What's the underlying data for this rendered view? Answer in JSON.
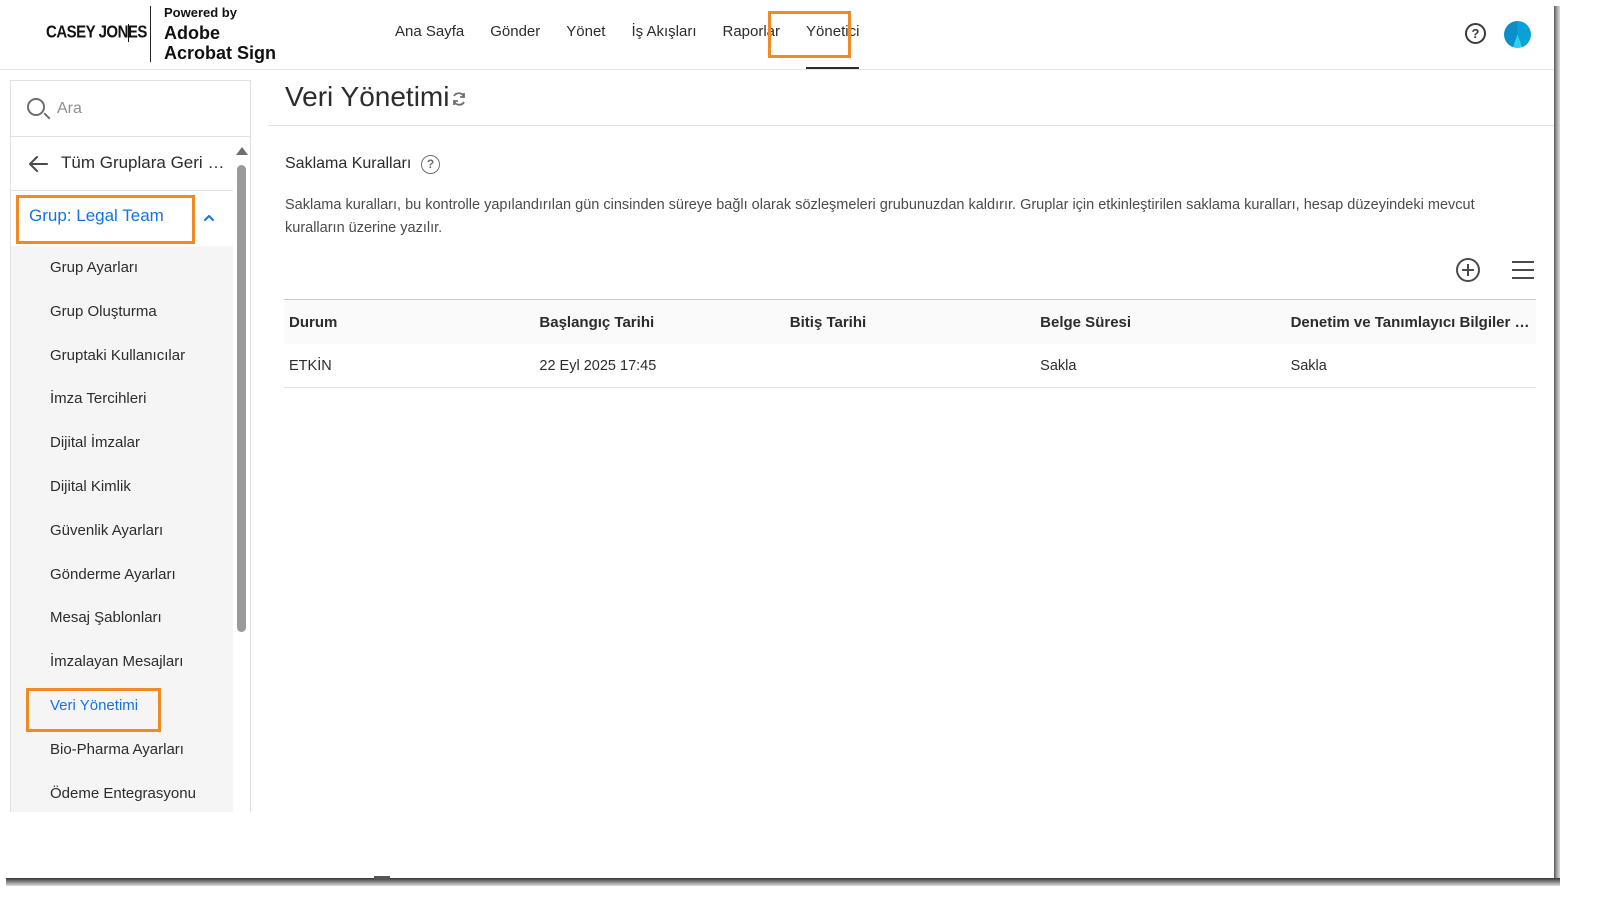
{
  "brand": {
    "company": "CASEY JONES",
    "powered_by": "Powered by",
    "product_line1": "Adobe",
    "product_line2": "Acrobat Sign"
  },
  "nav": {
    "items": [
      {
        "label": "Ana Sayfa"
      },
      {
        "label": "Gönder"
      },
      {
        "label": "Yönet"
      },
      {
        "label": "İş Akışları"
      },
      {
        "label": "Raporlar"
      },
      {
        "label": "Yönetici",
        "active": true
      }
    ],
    "help_glyph": "?"
  },
  "sidebar": {
    "search_placeholder": "Ara",
    "back_label": "Tüm Gruplara Geri Dön",
    "group_label": "Grup: Legal Team",
    "items": [
      {
        "label": "Grup Ayarları"
      },
      {
        "label": "Grup Oluşturma"
      },
      {
        "label": "Gruptaki Kullanıcılar"
      },
      {
        "label": "İmza Tercihleri"
      },
      {
        "label": "Dijital İmzalar"
      },
      {
        "label": "Dijital Kimlik"
      },
      {
        "label": "Güvenlik Ayarları"
      },
      {
        "label": "Gönderme Ayarları"
      },
      {
        "label": "Mesaj Şablonları"
      },
      {
        "label": "İmzalayan Mesajları"
      },
      {
        "label": "Veri Yönetimi",
        "selected": true
      },
      {
        "label": "Bio-Pharma Ayarları"
      },
      {
        "label": "Ödeme Entegrasyonu"
      }
    ]
  },
  "main": {
    "page_title": "Veri Yönetimi",
    "section_title": "Saklama Kuralları",
    "description": "Saklama kuralları, bu kontrolle yapılandırılan gün cinsinden süreye bağlı olarak sözleşmeleri grubunuzdan kaldırır. Gruplar için etkinleştirilen saklama kuralları, hesap düzeyindeki mevcut kuralların üzerine yazılır.",
    "table": {
      "headers": [
        "Durum",
        "Başlangıç Tarihi",
        "Bitiş Tarihi",
        "Belge Süresi",
        "Denetim ve Tanımlayıcı Bilgiler Süresi"
      ],
      "rows": [
        [
          "ETKİN",
          "22 Eyl 2025 17:45",
          "",
          "Sakla",
          "Sakla"
        ]
      ]
    }
  },
  "colors": {
    "accent_blue": "#1473e6",
    "highlight_orange": "#f08a24"
  }
}
